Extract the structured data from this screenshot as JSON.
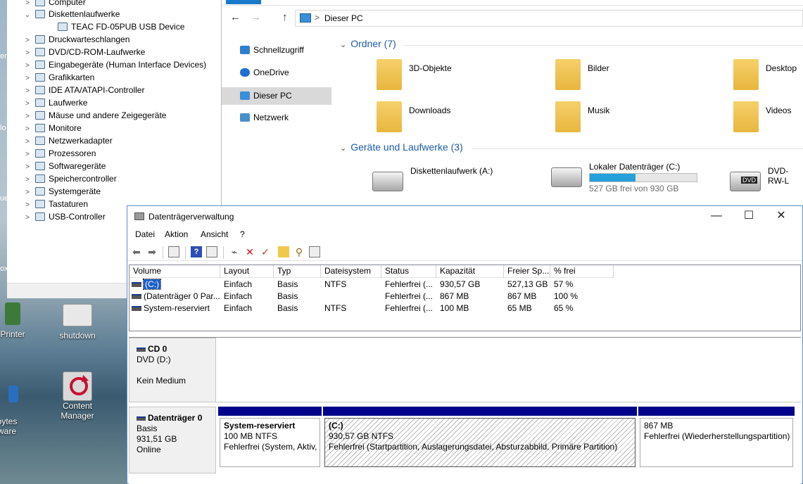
{
  "desktop": {
    "icons": [
      {
        "label": "Printer"
      },
      {
        "label": "shutdown"
      },
      {
        "label": "Content Manager"
      },
      {
        "label": "bytes\nware"
      }
    ],
    "edge_fragments": [
      "er",
      "lo",
      "ue",
      "ox"
    ]
  },
  "device_manager": {
    "tree": [
      {
        "label": "Computer",
        "expanded": false,
        "indent": 0
      },
      {
        "label": "Diskettenlaufwerke",
        "expanded": true,
        "indent": 0
      },
      {
        "label": "TEAC FD-05PUB USB Device",
        "expanded": false,
        "indent": 1
      },
      {
        "label": "Druckwarteschlangen",
        "expanded": false,
        "indent": 0
      },
      {
        "label": "DVD/CD-ROM-Laufwerke",
        "expanded": false,
        "indent": 0
      },
      {
        "label": "Eingabegeräte (Human Interface Devices)",
        "expanded": false,
        "indent": 0
      },
      {
        "label": "Grafikkarten",
        "expanded": false,
        "indent": 0
      },
      {
        "label": "IDE ATA/ATAPI-Controller",
        "expanded": false,
        "indent": 0
      },
      {
        "label": "Laufwerke",
        "expanded": false,
        "indent": 0
      },
      {
        "label": "Mäuse und andere Zeigegeräte",
        "expanded": false,
        "indent": 0
      },
      {
        "label": "Monitore",
        "expanded": false,
        "indent": 0
      },
      {
        "label": "Netzwerkadapter",
        "expanded": false,
        "indent": 0
      },
      {
        "label": "Prozessoren",
        "expanded": false,
        "indent": 0
      },
      {
        "label": "Softwaregeräte",
        "expanded": false,
        "indent": 0
      },
      {
        "label": "Speichercontroller",
        "expanded": false,
        "indent": 0
      },
      {
        "label": "Systemgeräte",
        "expanded": false,
        "indent": 0
      },
      {
        "label": "Tastaturen",
        "expanded": false,
        "indent": 0
      },
      {
        "label": "USB-Controller",
        "expanded": false,
        "indent": 0
      }
    ]
  },
  "explorer": {
    "address": {
      "back": "←",
      "forward": "→",
      "up": "↑",
      "separator": ">",
      "location": "Dieser PC"
    },
    "nav": [
      {
        "label": "Schnellzugriff",
        "color": "#2f7fd1",
        "selected": false
      },
      {
        "label": "OneDrive",
        "color": "#1f6fd1",
        "selected": false
      },
      {
        "label": "Dieser PC",
        "color": "#3b8ed8",
        "selected": true
      },
      {
        "label": "Netzwerk",
        "color": "#4a90c8",
        "selected": false
      }
    ],
    "folders_header": "Ordner (7)",
    "folders": [
      {
        "label": "3D-Objekte",
        "icon": "3d-objects-folder-icon"
      },
      {
        "label": "Bilder",
        "icon": "pictures-folder-icon"
      },
      {
        "label": "Desktop",
        "icon": "desktop-folder-icon"
      },
      {
        "label": "Downloads",
        "icon": "downloads-folder-icon"
      },
      {
        "label": "Musik",
        "icon": "music-folder-icon"
      },
      {
        "label": "Videos",
        "icon": "videos-folder-icon"
      }
    ],
    "drives_header": "Geräte und Laufwerke (3)",
    "drives": [
      {
        "label": "Diskettenlaufwerk (A:)",
        "sub": "",
        "fill": null
      },
      {
        "label": "Lokaler Datenträger (C:)",
        "sub": "527 GB frei von 930 GB",
        "fill": 0.43
      },
      {
        "label": "DVD-RW-L",
        "sub": "",
        "fill": null,
        "badge": "DVD"
      }
    ],
    "accent": "#26a0da"
  },
  "disk_mgmt": {
    "title": "Datenträgerverwaltung",
    "window_buttons": {
      "minimize": "—",
      "maximize": "☐",
      "close": "✕"
    },
    "menu": [
      "Datei",
      "Aktion",
      "Ansicht",
      "?"
    ],
    "columns": [
      "Volume",
      "Layout",
      "Typ",
      "Dateisystem",
      "Status",
      "Kapazität",
      "Freier Sp...",
      "% frei"
    ],
    "rows": [
      {
        "volume": "(C:)",
        "layout": "Einfach",
        "typ": "Basis",
        "fs": "NTFS",
        "status": "Fehlerfrei (...",
        "cap": "930,57 GB",
        "free": "527,13 GB",
        "pct": "57 %",
        "selected": true
      },
      {
        "volume": "(Datenträger 0 Par...",
        "layout": "Einfach",
        "typ": "Basis",
        "fs": "",
        "status": "Fehlerfrei (...",
        "cap": "867 MB",
        "free": "867 MB",
        "pct": "100 %",
        "selected": false
      },
      {
        "volume": "System-reserviert",
        "layout": "Einfach",
        "typ": "Basis",
        "fs": "NTFS",
        "status": "Fehlerfrei (...",
        "cap": "100 MB",
        "free": "65 MB",
        "pct": "65 %",
        "selected": false
      }
    ],
    "cd": {
      "name": "CD 0",
      "line1": "DVD (D:)",
      "line2": "Kein Medium"
    },
    "disk0": {
      "name": "Datenträger 0",
      "type": "Basis",
      "size": "931,51 GB",
      "state": "Online",
      "partitions": [
        {
          "title": "System-reserviert",
          "line1": "100 MB NTFS",
          "line2": "Fehlerfrei (System, Aktiv,",
          "hatched": false
        },
        {
          "title": "(C:)",
          "line1": "930,57 GB NTFS",
          "line2": "Fehlerfrei (Startpartition, Auslagerungsdatei, Absturzabbild, Primäre Partition)",
          "hatched": true
        },
        {
          "title": "",
          "line1": "867 MB",
          "line2": "Fehlerfrei (Wiederherstellungspartition)",
          "hatched": false
        }
      ]
    },
    "primary_color": "#00008b",
    "selection_color": "#1c5ec9"
  }
}
